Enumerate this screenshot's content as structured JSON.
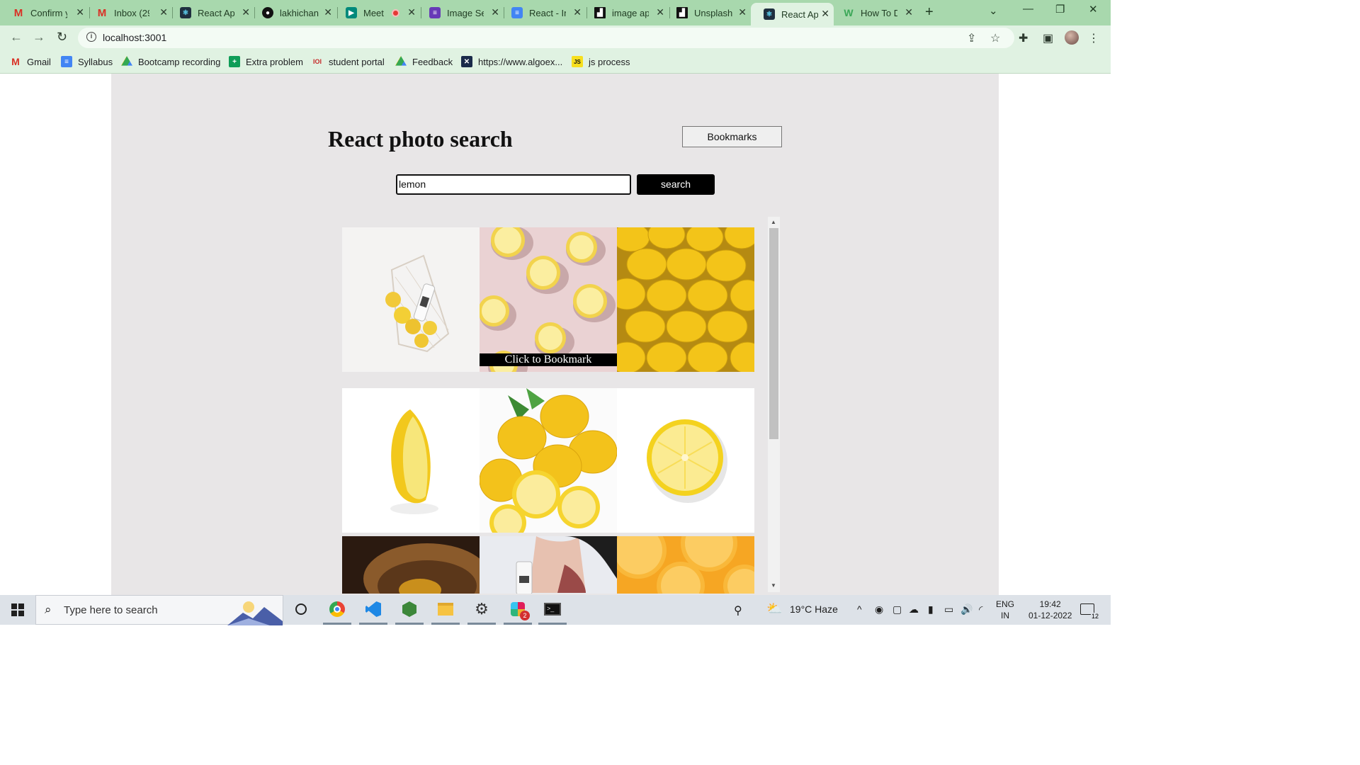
{
  "browser": {
    "tabs": [
      {
        "label": "Confirm y",
        "icon": "gmail-icon",
        "active": false
      },
      {
        "label": "Inbox (29",
        "icon": "gmail-icon",
        "active": false
      },
      {
        "label": "React Ap",
        "icon": "react-icon",
        "active": false
      },
      {
        "label": "lakhichan",
        "icon": "github-icon",
        "active": false
      },
      {
        "label": "Meet",
        "icon": "meet-icon",
        "active": false
      },
      {
        "label": "Image Se",
        "icon": "forms-icon",
        "active": false
      },
      {
        "label": "React - In",
        "icon": "docs-icon",
        "active": false
      },
      {
        "label": "image ap",
        "icon": "unsplash-icon",
        "active": false
      },
      {
        "label": "Unsplash",
        "icon": "unsplash-icon",
        "active": false
      },
      {
        "label": "React Ap",
        "icon": "react-icon",
        "active": true
      },
      {
        "label": "How To D",
        "icon": "wikihow-icon",
        "active": false
      }
    ],
    "url": "localhost:3001",
    "bookmarks": [
      {
        "label": "Gmail",
        "icon": "gmail-icon"
      },
      {
        "label": "Syllabus",
        "icon": "docs-icon"
      },
      {
        "label": "Bootcamp recording",
        "icon": "drive-icon"
      },
      {
        "label": "Extra problem",
        "icon": "sheets-icon"
      },
      {
        "label": "student portal",
        "icon": "portal-icon"
      },
      {
        "label": "Feedback",
        "icon": "drive-icon"
      },
      {
        "label": "https://www.algoex...",
        "icon": "algoexpert-icon"
      },
      {
        "label": "js process",
        "icon": "js-icon"
      }
    ]
  },
  "app": {
    "title": "React photo search",
    "bookmarks_button": "Bookmarks",
    "search": {
      "value": "lemon",
      "button": "search"
    },
    "photo_overlay_label": "Click to Bookmark",
    "photos": [
      "lemons in mesh bag with milk bottle",
      "halved lemons on pink background",
      "pile of whole lemons",
      "half lemon on white",
      "lemons and lemon slices",
      "single lemon slice on white",
      "lemons in wooden bowl",
      "woman holding bottle",
      "orange slices"
    ]
  },
  "taskbar": {
    "search_placeholder": "Type here to search",
    "weather": "19°C  Haze",
    "language": "ENG",
    "region": "IN",
    "time": "19:42",
    "date": "01-12-2022",
    "notifications": "12",
    "slack_badge": "2"
  },
  "colors": {
    "tab_bar": "#a8d8ad",
    "toolbar": "#e0f2e2",
    "app_background": "#e8e6e7",
    "search_button": "#000000"
  }
}
